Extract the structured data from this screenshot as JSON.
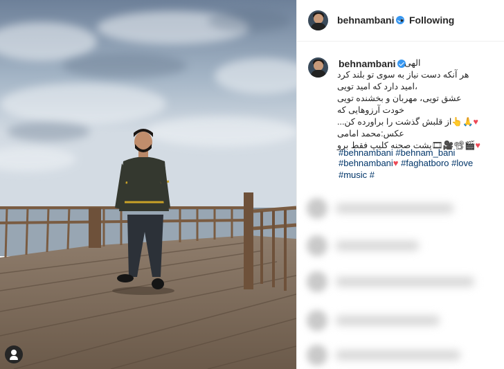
{
  "post": {
    "username": "behnambani",
    "verified": true,
    "dot": "•",
    "follow_status": "Following"
  },
  "caption": {
    "username": "behnambani",
    "lines": [
      "الهی",
      "هر آنکه دست نیاز به سوی تو بلند کرد",
      "،امید دارد که امید تویی",
      "عشق تویی، مهربان و بخشنده تویی",
      "خودت آرزوهایی که",
      "از قلبش گذشت را براورده کن...",
      "عکس:محمد امامی",
      "پشت صحنه کلیپ فقط برو"
    ],
    "line6_emoji": "🙏👆",
    "line8_emoji": "🎬📽🎥🎞"
  },
  "hashtags": {
    "line1": [
      "#behnambani",
      "#behnam_bani"
    ],
    "line2a": "#behnambani",
    "line2b": [
      "#faghatboro",
      "#love"
    ],
    "line3": "#music #"
  },
  "icons": {
    "user_tag": "user-tag-icon",
    "verified": "verified-badge-icon"
  },
  "colors": {
    "link": "#003569",
    "verified": "#3897f0",
    "heart": "#ed4956"
  }
}
